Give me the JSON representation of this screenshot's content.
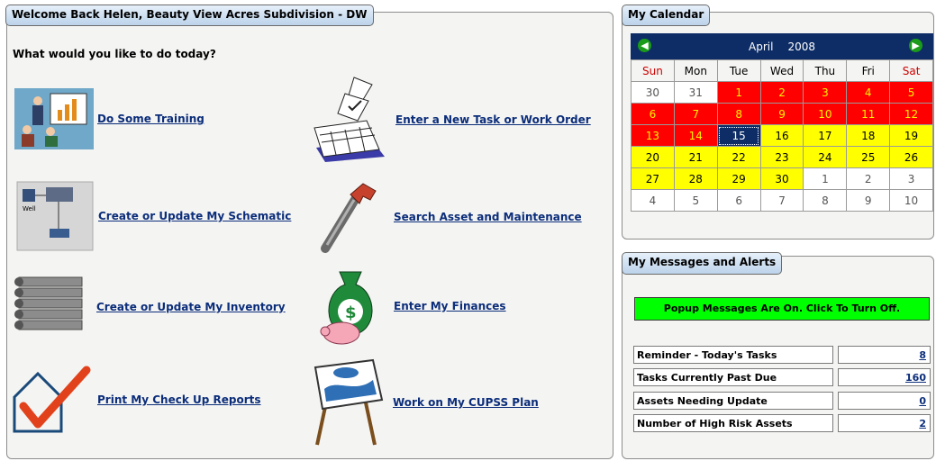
{
  "welcome": {
    "title": "Welcome Back Helen, Beauty View Acres Subdivision - DW",
    "prompt": "What would you like to do today?"
  },
  "actions": [
    {
      "label": "Do Some Training",
      "icon": "training-icon"
    },
    {
      "label": "Enter a New Task or Work Order",
      "icon": "task-calendar-icon"
    },
    {
      "label": "Create or Update My Schematic",
      "icon": "schematic-icon"
    },
    {
      "label": "Search Asset and Maintenance",
      "icon": "wrench-icon"
    },
    {
      "label": "Create or Update My Inventory",
      "icon": "pipes-icon"
    },
    {
      "label": "Enter My Finances",
      "icon": "money-bag-icon"
    },
    {
      "label": "Print My Check Up Reports",
      "icon": "checkmark-house-icon"
    },
    {
      "label": "Work on My CUPSS Plan",
      "icon": "cupss-easel-icon"
    }
  ],
  "calendar": {
    "title": "My Calendar",
    "month": "April",
    "year": "2008",
    "prev_icon": "green-left-arrow-icon",
    "next_icon": "green-right-arrow-icon",
    "weekdays": [
      "Sun",
      "Mon",
      "Tue",
      "Wed",
      "Thu",
      "Fri",
      "Sat"
    ],
    "weeks": [
      [
        "30",
        "31",
        "1",
        "2",
        "3",
        "4",
        "5"
      ],
      [
        "6",
        "7",
        "8",
        "9",
        "10",
        "11",
        "12"
      ],
      [
        "13",
        "14",
        "15",
        "16",
        "17",
        "18",
        "19"
      ],
      [
        "20",
        "21",
        "22",
        "23",
        "24",
        "25",
        "26"
      ],
      [
        "27",
        "28",
        "29",
        "30",
        "1",
        "2",
        "3"
      ],
      [
        "4",
        "5",
        "6",
        "7",
        "8",
        "9",
        "10"
      ]
    ],
    "status": [
      [
        "w",
        "w",
        "r",
        "r",
        "r",
        "r",
        "r"
      ],
      [
        "r",
        "r",
        "r",
        "r",
        "r",
        "r",
        "r"
      ],
      [
        "r",
        "r",
        "today",
        "y",
        "y",
        "y",
        "y"
      ],
      [
        "y",
        "y",
        "y",
        "y",
        "y",
        "y",
        "y"
      ],
      [
        "y",
        "y",
        "y",
        "y",
        "w",
        "w",
        "w"
      ],
      [
        "w",
        "w",
        "w",
        "w",
        "w",
        "w",
        "w"
      ]
    ],
    "colors": {
      "overdue": "#ff0000",
      "upcoming": "#ffff00",
      "today": "#0e2d66",
      "header": "#0e2d66"
    }
  },
  "messages": {
    "title": "My Messages and Alerts",
    "popup_button": "Popup Messages Are On. Click To Turn Off.",
    "popup_color": "#00ff00",
    "alerts": [
      {
        "label": "Reminder - Today's Tasks",
        "value": "8"
      },
      {
        "label": "Tasks Currently Past Due",
        "value": "160"
      },
      {
        "label": "Assets Needing Update",
        "value": "0"
      },
      {
        "label": "Number of High Risk Assets",
        "value": "2"
      }
    ]
  }
}
